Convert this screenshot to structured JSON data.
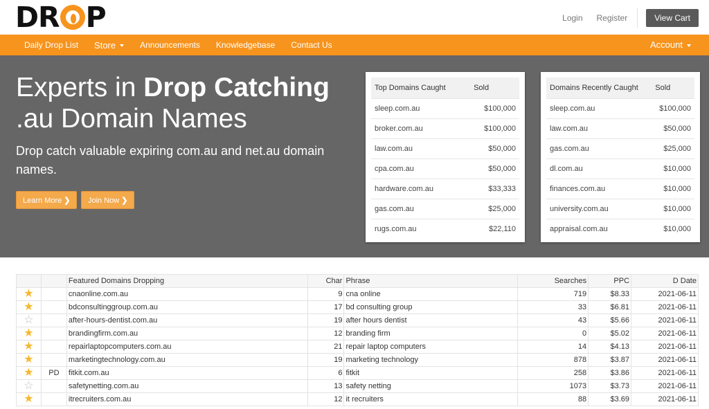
{
  "brand": {
    "logo_text_left": "DR",
    "logo_text_right": "P"
  },
  "header": {
    "login": "Login",
    "register": "Register",
    "cart": "View Cart"
  },
  "nav": {
    "items": [
      "Daily Drop List",
      "Store",
      "Announcements",
      "Knowledgebase",
      "Contact Us"
    ],
    "account": "Account"
  },
  "hero": {
    "title_plain": "Experts in ",
    "title_bold": "Drop Catching",
    "title_line2": ".au Domain Names",
    "subtitle": "Drop catch valuable expiring com.au and net.au domain names.",
    "btn_learn": "Learn More",
    "btn_join": "Join Now",
    "chevron": "❯"
  },
  "top_caught": {
    "headers": [
      "Top Domains Caught",
      "Sold"
    ],
    "rows": [
      [
        "sleep.com.au",
        "$100,000"
      ],
      [
        "broker.com.au",
        "$100,000"
      ],
      [
        "law.com.au",
        "$50,000"
      ],
      [
        "cpa.com.au",
        "$50,000"
      ],
      [
        "hardware.com.au",
        "$33,333"
      ],
      [
        "gas.com.au",
        "$25,000"
      ],
      [
        "rugs.com.au",
        "$22,110"
      ]
    ]
  },
  "recent_caught": {
    "headers": [
      "Domains Recently Caught",
      "Sold"
    ],
    "rows": [
      [
        "sleep.com.au",
        "$100,000"
      ],
      [
        "law.com.au",
        "$50,000"
      ],
      [
        "gas.com.au",
        "$25,000"
      ],
      [
        "dl.com.au",
        "$10,000"
      ],
      [
        "finances.com.au",
        "$10,000"
      ],
      [
        "university.com.au",
        "$10,000"
      ],
      [
        "appraisal.com.au",
        "$10,000"
      ]
    ]
  },
  "featured": {
    "headers": [
      "",
      "",
      "Featured Domains Dropping",
      "Char",
      "Phrase",
      "Searches",
      "PPC",
      "D Date"
    ],
    "rows": [
      {
        "star": true,
        "tag": "",
        "domain": "cnaonline.com.au",
        "char": "9",
        "phrase": "cna online",
        "searches": "719",
        "ppc": "$8.33",
        "date": "2021-06-11"
      },
      {
        "star": true,
        "tag": "",
        "domain": "bdconsultinggroup.com.au",
        "char": "17",
        "phrase": "bd consulting group",
        "searches": "33",
        "ppc": "$6.81",
        "date": "2021-06-11"
      },
      {
        "star": false,
        "tag": "",
        "domain": "after-hours-dentist.com.au",
        "char": "19",
        "phrase": "after hours dentist",
        "searches": "43",
        "ppc": "$5.66",
        "date": "2021-06-11"
      },
      {
        "star": true,
        "tag": "",
        "domain": "brandingfirm.com.au",
        "char": "12",
        "phrase": "branding firm",
        "searches": "0",
        "ppc": "$5.02",
        "date": "2021-06-11"
      },
      {
        "star": true,
        "tag": "",
        "domain": "repairlaptopcomputers.com.au",
        "char": "21",
        "phrase": "repair laptop computers",
        "searches": "14",
        "ppc": "$4.13",
        "date": "2021-06-11"
      },
      {
        "star": true,
        "tag": "",
        "domain": "marketingtechnology.com.au",
        "char": "19",
        "phrase": "marketing technology",
        "searches": "878",
        "ppc": "$3.87",
        "date": "2021-06-11"
      },
      {
        "star": true,
        "tag": "PD",
        "domain": "fitkit.com.au",
        "char": "6",
        "phrase": "fitkit",
        "searches": "258",
        "ppc": "$3.86",
        "date": "2021-06-11"
      },
      {
        "star": false,
        "tag": "",
        "domain": "safetynetting.com.au",
        "char": "13",
        "phrase": "safety netting",
        "searches": "1073",
        "ppc": "$3.73",
        "date": "2021-06-11"
      },
      {
        "star": true,
        "tag": "",
        "domain": "itrecruiters.com.au",
        "char": "12",
        "phrase": "it recruiters",
        "searches": "88",
        "ppc": "$3.69",
        "date": "2021-06-11"
      }
    ]
  },
  "colors": {
    "accent": "#f7941d",
    "hero_bg": "#666666",
    "star": "#f6b830"
  }
}
